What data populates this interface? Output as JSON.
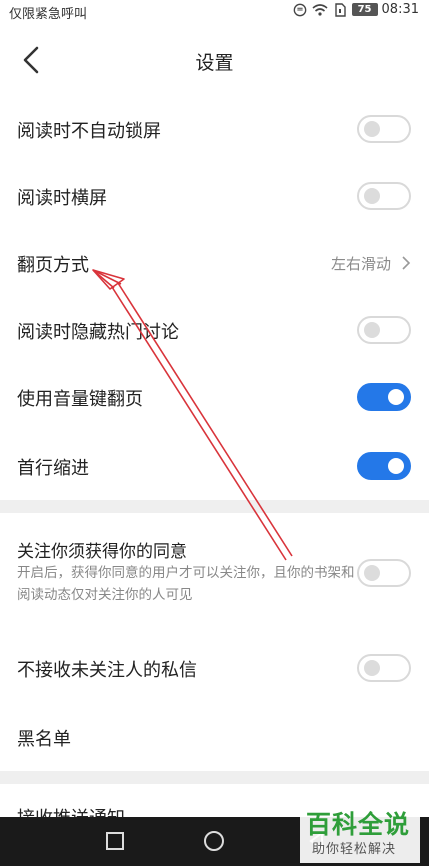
{
  "status_bar": {
    "carrier": "仅限紧急呼叫",
    "battery": "75",
    "time": "08:31"
  },
  "header": {
    "title": "设置"
  },
  "settings": [
    {
      "label": "阅读时不自动锁屏",
      "type": "toggle",
      "on": false
    },
    {
      "label": "阅读时横屏",
      "type": "toggle",
      "on": false
    },
    {
      "label": "翻页方式",
      "type": "select",
      "value": "左右滑动"
    },
    {
      "label": "阅读时隐藏热门讨论",
      "type": "toggle",
      "on": false
    },
    {
      "label": "使用音量键翻页",
      "type": "toggle",
      "on": true
    },
    {
      "label": "首行缩进",
      "type": "toggle",
      "on": true
    }
  ],
  "privacy": [
    {
      "label": "关注你须获得你的同意",
      "description": "开启后，获得你同意的用户才可以关注你，且你的书架和阅读动态仅对关注你的人可见",
      "type": "toggle",
      "on": false
    },
    {
      "label": "不接收未关注人的私信",
      "type": "toggle",
      "on": false
    },
    {
      "label": "黑名单",
      "type": "link"
    }
  ],
  "partial_row": {
    "label": "接收推送通知"
  },
  "watermark": {
    "main": "百科全说",
    "sub": "助你轻松解决"
  },
  "colors": {
    "accent": "#2478e8",
    "annotation_arrow": "#d9343b",
    "watermark_green": "#2f9e3a"
  },
  "icons": {
    "back": "chevron-left-icon",
    "select": "chevron-right-icon",
    "nav": [
      "square-icon",
      "circle-icon",
      "triangle-icon"
    ]
  }
}
